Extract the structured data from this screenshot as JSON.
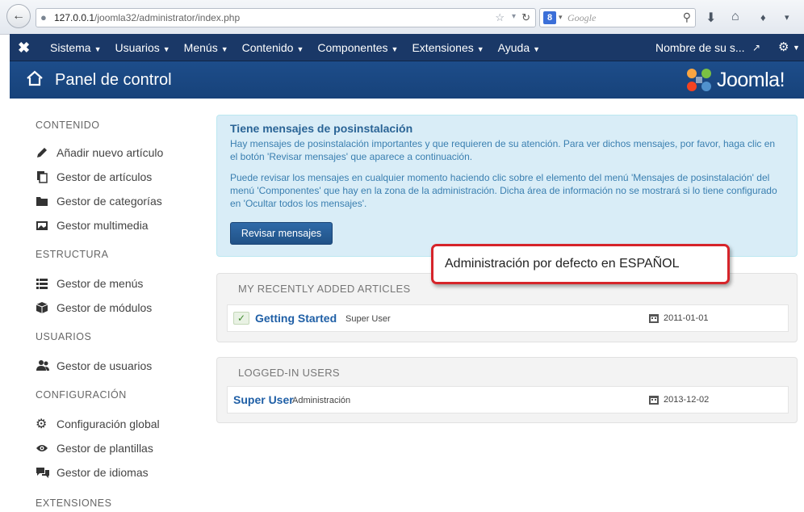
{
  "browser": {
    "url_host": "127.0.0.1",
    "url_path": "/joomla32/administrator/index.php",
    "search_placeholder": "Google",
    "search_engine_letter": "8"
  },
  "topnav": {
    "items": [
      {
        "label": "Sistema"
      },
      {
        "label": "Usuarios"
      },
      {
        "label": "Menús"
      },
      {
        "label": "Contenido"
      },
      {
        "label": "Componentes"
      },
      {
        "label": "Extensiones"
      },
      {
        "label": "Ayuda"
      }
    ],
    "site_name": "Nombre de su s..."
  },
  "header": {
    "title": "Panel de control",
    "brand": "Joomla!"
  },
  "sidebar": {
    "contenido": {
      "title": "CONTENIDO",
      "items": [
        {
          "label": "Añadir nuevo artículo",
          "icon": "pencil-icon"
        },
        {
          "label": "Gestor de artículos",
          "icon": "copy-icon"
        },
        {
          "label": "Gestor de categorías",
          "icon": "folder-icon"
        },
        {
          "label": "Gestor multimedia",
          "icon": "image-icon"
        }
      ]
    },
    "estructura": {
      "title": "ESTRUCTURA",
      "items": [
        {
          "label": "Gestor de menús",
          "icon": "list-icon"
        },
        {
          "label": "Gestor de módulos",
          "icon": "cube-icon"
        }
      ]
    },
    "usuarios": {
      "title": "USUARIOS",
      "items": [
        {
          "label": "Gestor de usuarios",
          "icon": "users-icon"
        }
      ]
    },
    "configuracion": {
      "title": "CONFIGURACIÓN",
      "items": [
        {
          "label": "Configuración global",
          "icon": "cog-icon"
        },
        {
          "label": "Gestor de plantillas",
          "icon": "eye-icon"
        },
        {
          "label": "Gestor de idiomas",
          "icon": "comments-icon"
        }
      ]
    },
    "extensiones": {
      "title": "EXTENSIONES"
    }
  },
  "alert": {
    "title": "Tiene mensajes de posinstalación",
    "text1": "Hay mensajes de posinstalación importantes y que requieren de su atención. Para ver dichos mensajes, por favor, haga clic en el botón 'Revisar mensajes' que aparece a continuación.",
    "text2": "Puede revisar los mensajes en cualquier momento haciendo clic sobre el elemento del menú 'Mensajes de posinstalación' del menú 'Componentes' que hay en la zona de la administración. Dicha área de información no se mostrará si lo tiene configurado en 'Ocultar todos los mensajes'.",
    "button": "Revisar mensajes"
  },
  "recent_articles": {
    "title": "MY RECENTLY ADDED ARTICLES",
    "rows": [
      {
        "title": "Getting Started",
        "author": "Super User",
        "date": "2011-01-01"
      }
    ]
  },
  "logged_users": {
    "title": "LOGGED-IN USERS",
    "rows": [
      {
        "name": "Super User",
        "area": "Administración",
        "date": "2013-12-02"
      }
    ]
  },
  "callout": {
    "text": "Administración por defecto en ESPAÑOL"
  },
  "colors": {
    "navbar": "#1a3867",
    "header": "#1d4d8a",
    "alert_bg": "#d9edf7",
    "link": "#1f5fa6",
    "callout_border": "#d6242a"
  }
}
